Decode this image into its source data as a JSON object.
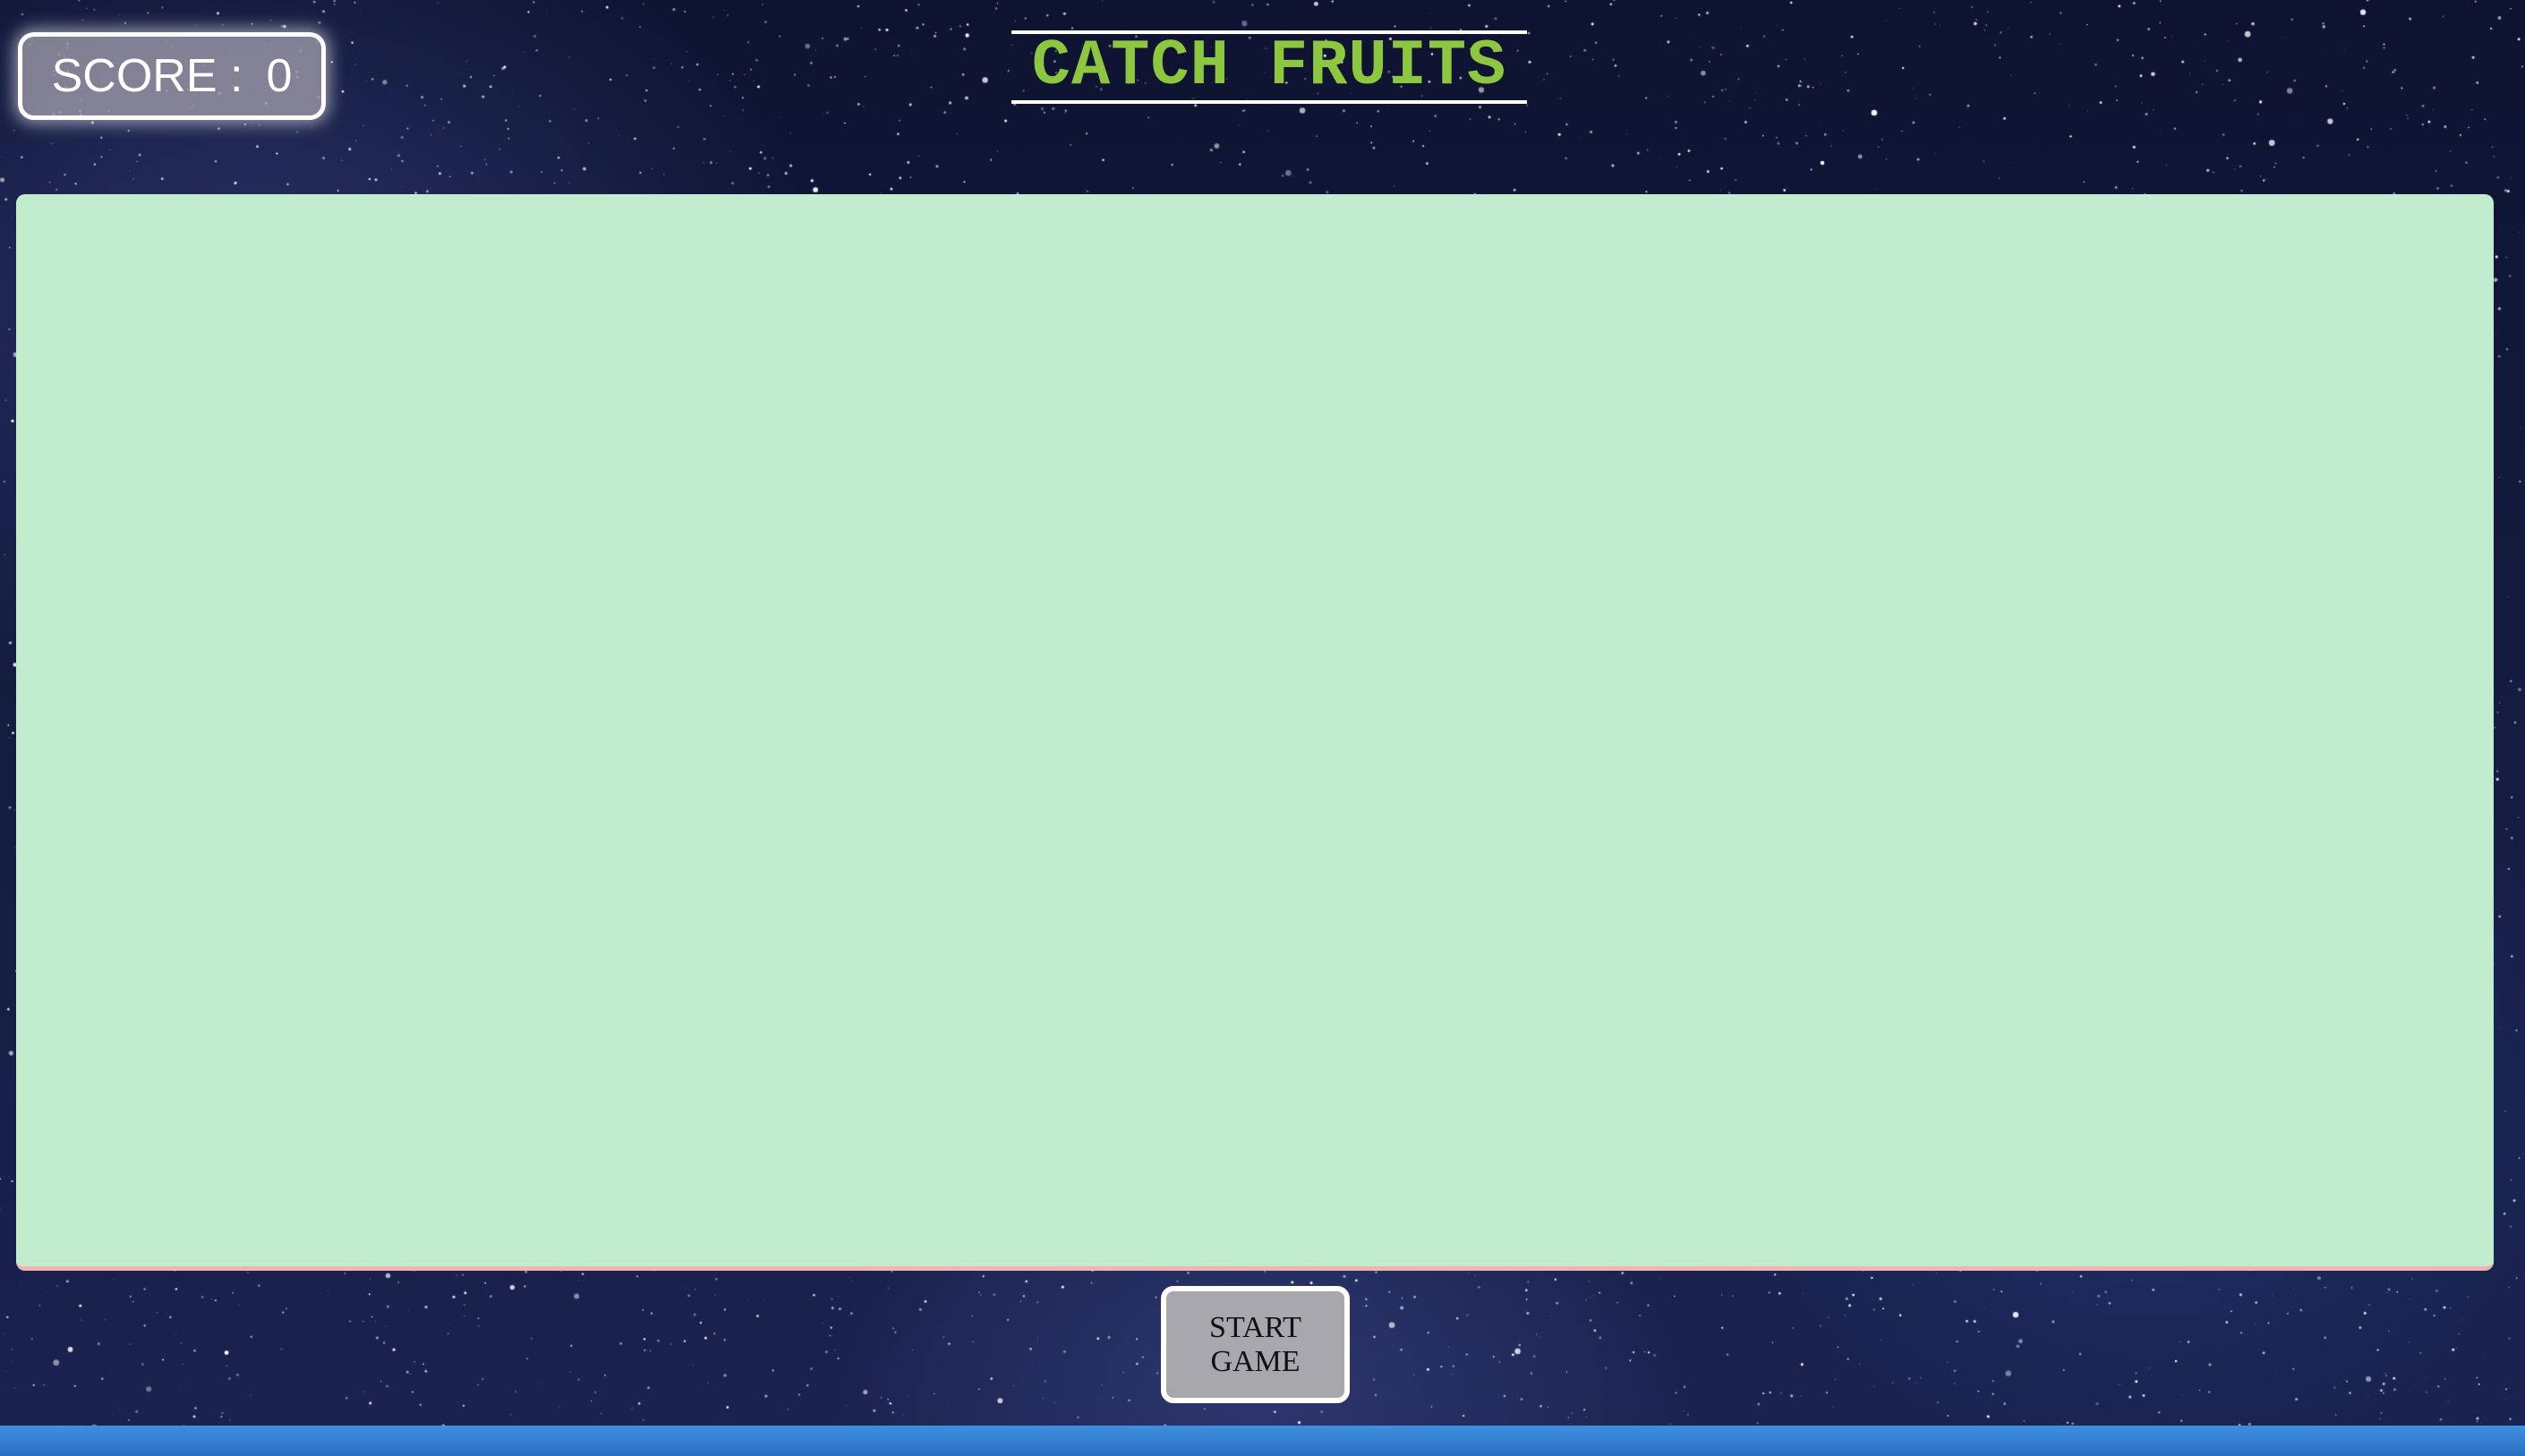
{
  "score": {
    "label": "SCORE :",
    "value": "0"
  },
  "title": "CATCH FRUITS",
  "controls": {
    "start_label": "START GAME"
  },
  "colors": {
    "title": "#8dc63f",
    "play_area": "#c1edce",
    "play_area_border": "#f3b3b3",
    "button_bg": "#a7a7ac",
    "bottom_bar": "#3d8fe0"
  }
}
